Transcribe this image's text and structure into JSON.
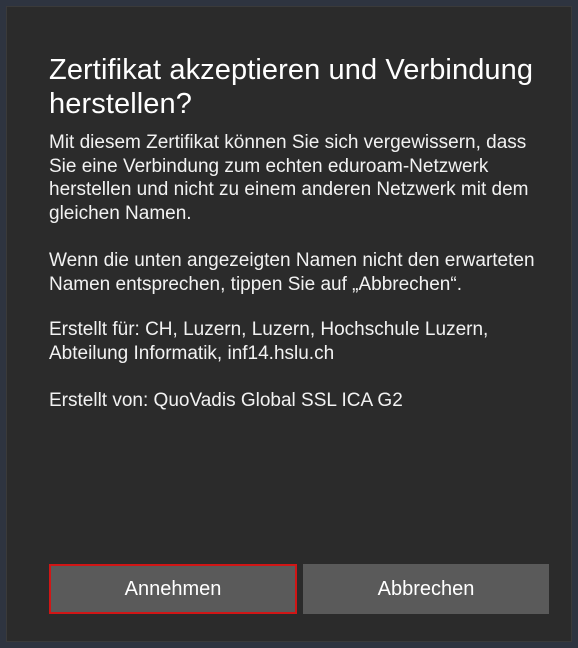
{
  "dialog": {
    "title": "Zertifikat akzeptieren und Verbindung herstellen?",
    "paragraph_1": "Mit diesem Zertifikat können Sie sich vergewissern, dass Sie eine Verbindung zum echten eduroam-Netzwerk herstellen und nicht zu einem anderen Netzwerk mit dem gleichen Namen.",
    "paragraph_2": "Wenn die unten angezeigten Namen nicht den erwarteten Namen entsprechen, tippen Sie auf „Abbrechen“.",
    "issued_to": "Erstellt für: CH, Luzern, Luzern, Hochschule Luzern, Abteilung Informatik, inf14.hslu.ch",
    "issued_by": "Erstellt von: QuoVadis Global SSL ICA G2"
  },
  "buttons": {
    "accept_label": "Annehmen",
    "cancel_label": "Abbrechen"
  },
  "colors": {
    "dialog_background": "#2b2b2b",
    "button_background": "#5a5a5a",
    "focus_border": "#d01616",
    "text": "#ffffff"
  }
}
